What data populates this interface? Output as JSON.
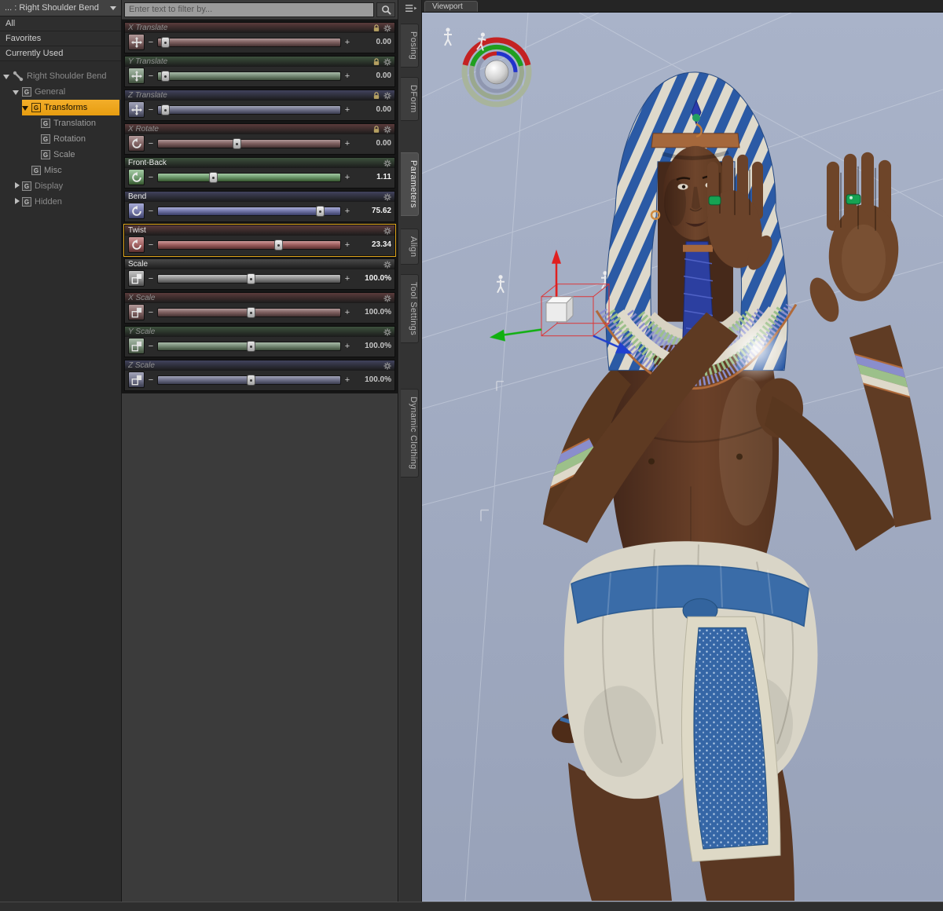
{
  "left": {
    "selector_label": "... : Right Shoulder Bend",
    "items": [
      "All",
      "Favorites",
      "Currently Used"
    ],
    "tree": [
      {
        "label": "Right Shoulder Bend",
        "level": 0,
        "arrow": "down",
        "icon": "bone",
        "dim": true
      },
      {
        "label": "General",
        "level": 1,
        "arrow": "down",
        "icon": "g",
        "dim": true
      },
      {
        "label": "Transforms",
        "level": 2,
        "arrow": "down",
        "icon": "g",
        "selected": true
      },
      {
        "label": "Translation",
        "level": 3,
        "icon": "g"
      },
      {
        "label": "Rotation",
        "level": 3,
        "icon": "g"
      },
      {
        "label": "Scale",
        "level": 3,
        "icon": "g"
      },
      {
        "label": "Misc",
        "level": 2,
        "icon": "g"
      },
      {
        "label": "Display",
        "level": 1,
        "arrow": "right",
        "icon": "g",
        "dim": true
      },
      {
        "label": "Hidden",
        "level": 1,
        "arrow": "right",
        "icon": "g",
        "dim": true
      }
    ]
  },
  "params": {
    "filter_placeholder": "Enter text to filter by...",
    "sliders": [
      {
        "label": "X Translate",
        "value": "0.00",
        "axis": "red",
        "kind": "move",
        "dim": true,
        "locked": true,
        "pct": 4
      },
      {
        "label": "Y Translate",
        "value": "0.00",
        "axis": "green",
        "kind": "move",
        "dim": true,
        "locked": true,
        "pct": 4
      },
      {
        "label": "Z Translate",
        "value": "0.00",
        "axis": "blue",
        "kind": "move",
        "dim": true,
        "locked": true,
        "pct": 4
      },
      {
        "label": "X Rotate",
        "value": "0.00",
        "axis": "red",
        "kind": "rotate",
        "dim": true,
        "locked": true,
        "pct": 43
      },
      {
        "label": "Front-Back",
        "value": "1.11",
        "axis": "green",
        "kind": "rotate",
        "pct": 30
      },
      {
        "label": "Bend",
        "value": "75.62",
        "axis": "blue",
        "kind": "rotate",
        "pct": 89
      },
      {
        "label": "Twist",
        "value": "23.34",
        "axis": "red",
        "kind": "rotate",
        "selected": true,
        "pct": 66
      },
      {
        "label": "Scale",
        "value": "100.0%",
        "axis": "gray",
        "kind": "scale",
        "pct": 51
      },
      {
        "label": "X Scale",
        "value": "100.0%",
        "axis": "red",
        "kind": "scale",
        "dim": true,
        "pct": 51
      },
      {
        "label": "Y Scale",
        "value": "100.0%",
        "axis": "green",
        "kind": "scale",
        "dim": true,
        "pct": 51
      },
      {
        "label": "Z Scale",
        "value": "100.0%",
        "axis": "blue",
        "kind": "scale",
        "dim": true,
        "pct": 51
      }
    ]
  },
  "side_tabs": [
    "Posing",
    "DForm",
    "Parameters",
    "Align",
    "Tool Settings",
    "Dynamic Clothing"
  ],
  "active_side_tab": "Parameters",
  "viewport": {
    "tab_label": "Viewport"
  },
  "colors": {
    "accent": "#efa41d",
    "axis_red": "#a06060",
    "axis_green": "#6e9a6e",
    "axis_blue": "#7478aa",
    "axis_gray": "#909090",
    "viewport_bg": "#a3adc4"
  }
}
